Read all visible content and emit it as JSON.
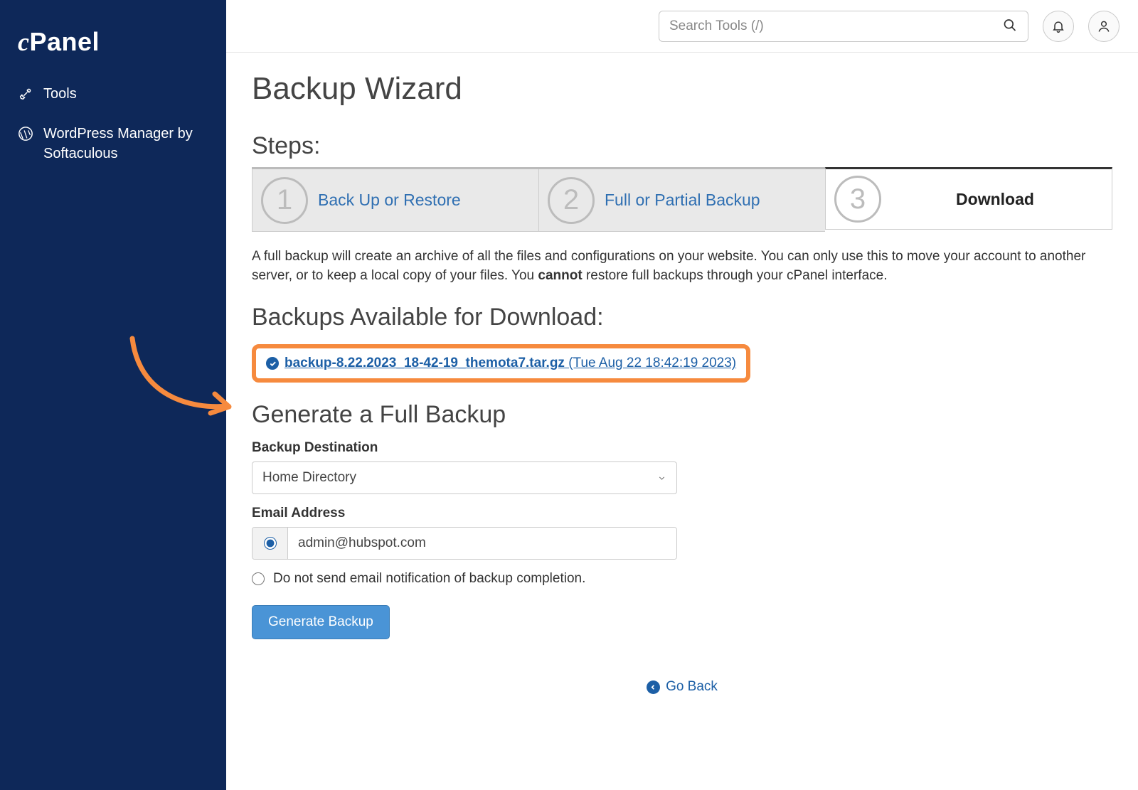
{
  "brand": "cPanel",
  "sidebar": {
    "items": [
      {
        "label": "Tools"
      },
      {
        "label": "WordPress Manager by Softaculous"
      }
    ]
  },
  "topbar": {
    "search_placeholder": "Search Tools (/)"
  },
  "page": {
    "title": "Backup Wizard",
    "steps_heading": "Steps:",
    "steps": [
      {
        "num": "1",
        "label": "Back Up or Restore"
      },
      {
        "num": "2",
        "label": "Full or Partial Backup"
      },
      {
        "num": "3",
        "label": "Download"
      }
    ],
    "description_pre": "A full backup will create an archive of all the files and configurations on your website. You can only use this to move your account to another server, or to keep a local copy of your files. You ",
    "description_bold": "cannot",
    "description_post": " restore full backups through your cPanel interface.",
    "avail_heading": "Backups Available for Download:",
    "backup_file": " backup-8.22.2023_18-42-19_themota7.tar.gz",
    "backup_date": " (Tue Aug 22 18:42:19 2023)",
    "gen_heading": "Generate a Full Backup",
    "dest_label": "Backup Destination",
    "dest_value": "Home Directory",
    "email_label": "Email Address",
    "email_value": "admin@hubspot.com",
    "no_email_label": "Do not send email notification of backup completion.",
    "gen_button": "Generate Backup",
    "go_back": "Go Back"
  }
}
